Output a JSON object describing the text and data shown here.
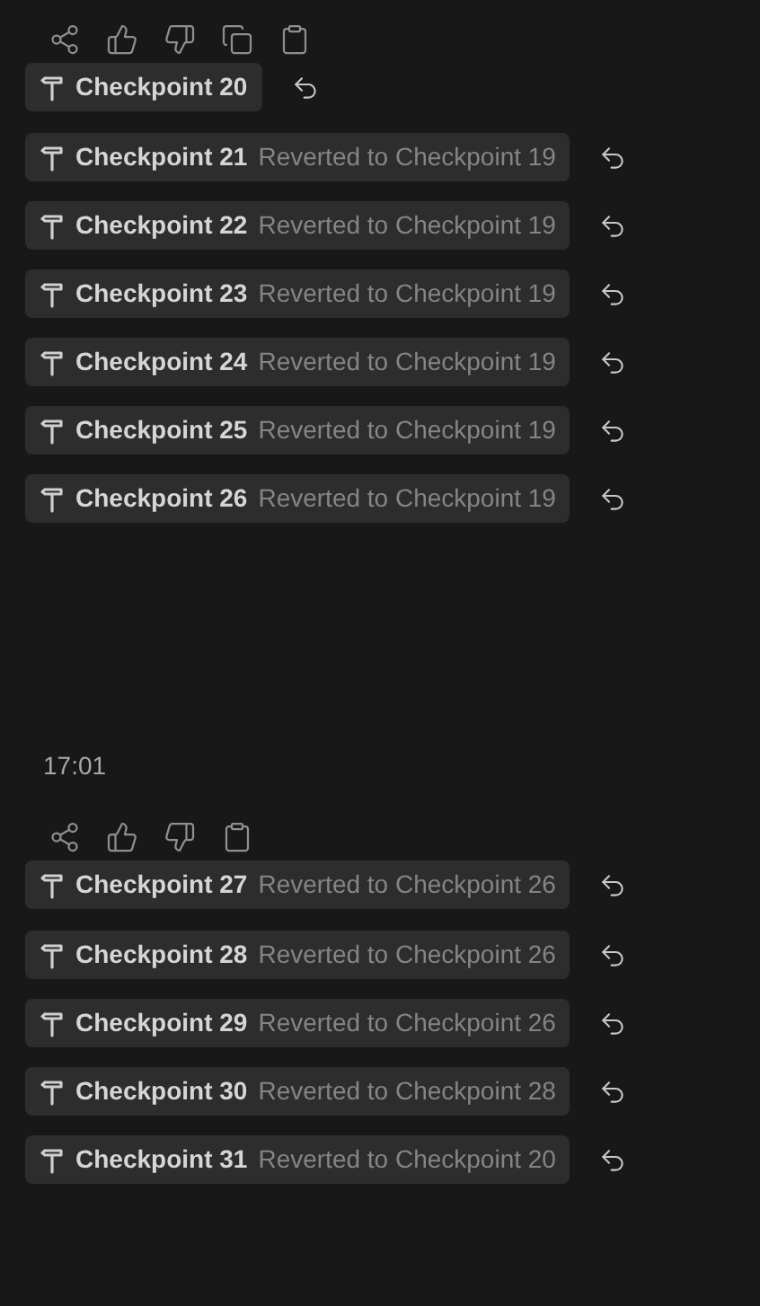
{
  "groups": [
    {
      "actions": [
        {
          "kind": "share"
        },
        {
          "kind": "thumbs-up"
        },
        {
          "kind": "thumbs-down"
        },
        {
          "kind": "copy"
        },
        {
          "kind": "clipboard"
        }
      ],
      "checkpoints": [
        {
          "label": "Checkpoint 20"
        },
        {
          "label": "Checkpoint 21",
          "note": "Reverted to Checkpoint 19"
        },
        {
          "label": "Checkpoint 22",
          "note": "Reverted to Checkpoint 19"
        },
        {
          "label": "Checkpoint 23",
          "note": "Reverted to Checkpoint 19"
        },
        {
          "label": "Checkpoint 24",
          "note": "Reverted to Checkpoint 19"
        },
        {
          "label": "Checkpoint 25",
          "note": "Reverted to Checkpoint 19"
        },
        {
          "label": "Checkpoint 26",
          "note": "Reverted to Checkpoint 19"
        }
      ]
    },
    {
      "time": "17:01",
      "actions": [
        {
          "kind": "share"
        },
        {
          "kind": "thumbs-up"
        },
        {
          "kind": "thumbs-down"
        },
        {
          "kind": "clipboard"
        }
      ],
      "checkpoints": [
        {
          "label": "Checkpoint 27",
          "note": "Reverted to Checkpoint 26"
        },
        {
          "label": "Checkpoint 28",
          "note": "Reverted to Checkpoint 26"
        },
        {
          "label": "Checkpoint 29",
          "note": "Reverted to Checkpoint 26"
        },
        {
          "label": "Checkpoint 30",
          "note": "Reverted to Checkpoint 28"
        },
        {
          "label": "Checkpoint 31",
          "note": "Reverted to Checkpoint 20"
        }
      ]
    }
  ]
}
